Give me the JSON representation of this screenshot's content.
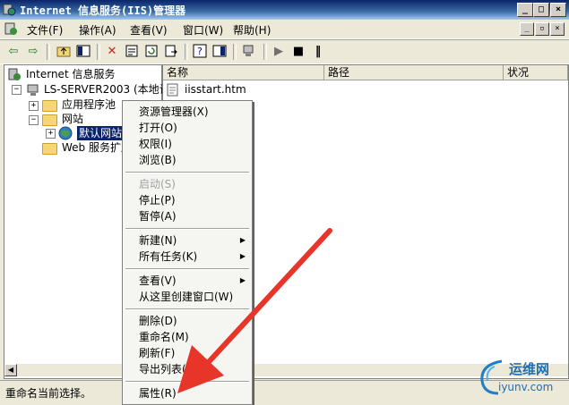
{
  "window": {
    "title": "Internet 信息服务(IIS)管理器"
  },
  "menubar": {
    "items": [
      "文件(F)",
      "操作(A)",
      "查看(V)",
      "窗口(W)",
      "帮助(H)"
    ]
  },
  "tree": {
    "root": "Internet 信息服务",
    "server": "LS-SERVER2003 (本地计算机)",
    "app_pools": "应用程序池",
    "websites": "网站",
    "default_site": "默认网站",
    "web_ext": "Web 服务扩展"
  },
  "list": {
    "columns": [
      "名称",
      "路径",
      "状况"
    ],
    "rows": [
      {
        "name": "iisstart.htm"
      }
    ]
  },
  "context_menu": {
    "items": [
      {
        "label": "资源管理器(X)",
        "disabled": false
      },
      {
        "label": "打开(O)",
        "disabled": false
      },
      {
        "label": "权限(I)",
        "disabled": false
      },
      {
        "label": "浏览(B)",
        "disabled": false
      },
      {
        "label": "启动(S)",
        "disabled": true
      },
      {
        "label": "停止(P)",
        "disabled": false
      },
      {
        "label": "暂停(A)",
        "disabled": false
      },
      {
        "label": "新建(N)",
        "disabled": false,
        "submenu": true
      },
      {
        "label": "所有任务(K)",
        "disabled": false,
        "submenu": true
      },
      {
        "label": "查看(V)",
        "disabled": false,
        "submenu": true
      },
      {
        "label": "从这里创建窗口(W)",
        "disabled": false
      },
      {
        "label": "删除(D)",
        "disabled": false
      },
      {
        "label": "重命名(M)",
        "disabled": false
      },
      {
        "label": "刷新(F)",
        "disabled": false
      },
      {
        "label": "导出列表(L)...",
        "disabled": false
      },
      {
        "label": "属性(R)",
        "disabled": false
      }
    ]
  },
  "statusbar": {
    "text": "重命名当前选择。"
  },
  "watermark": {
    "text": "运维网",
    "url": "iyunv.com"
  },
  "colors": {
    "title_bar": "#0a246a",
    "selection": "#0a246a",
    "arrow": "#e8352a"
  }
}
